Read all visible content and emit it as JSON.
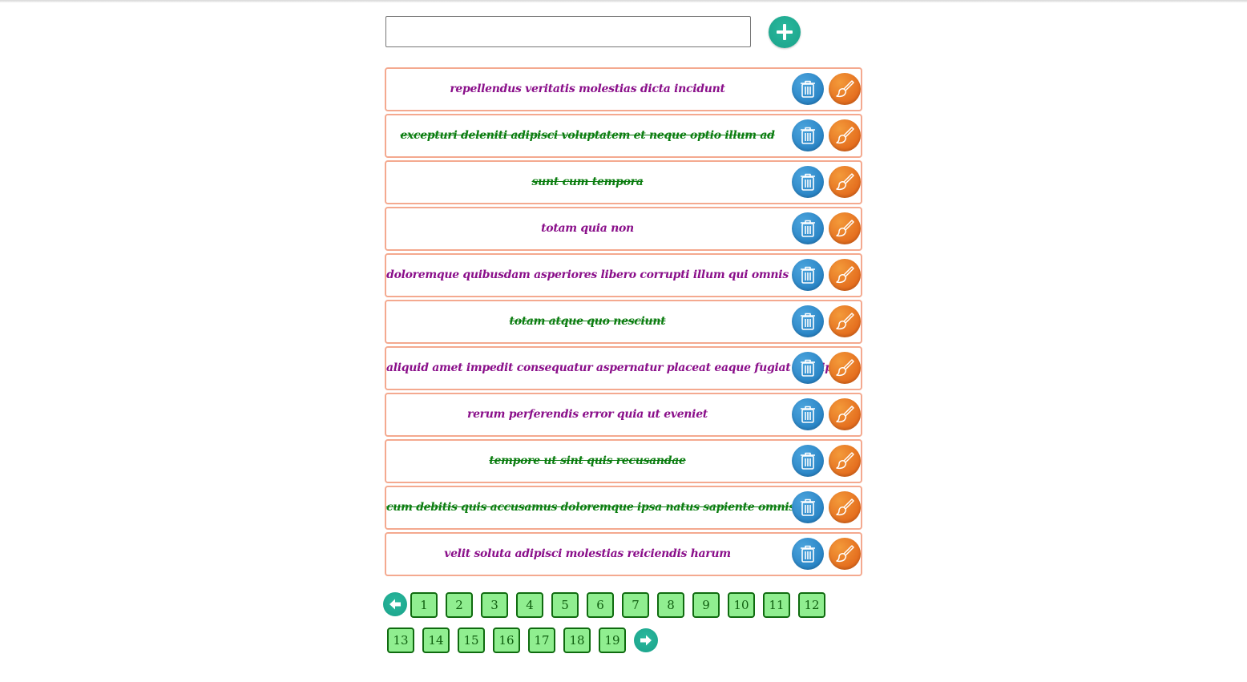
{
  "input": {
    "value": "",
    "placeholder": ""
  },
  "todos": [
    {
      "text": "repellendus veritatis molestias dicta incidunt",
      "completed": false
    },
    {
      "text": "excepturi deleniti adipisci voluptatem et neque optio illum ad",
      "completed": true
    },
    {
      "text": "sunt cum tempora",
      "completed": true
    },
    {
      "text": "totam quia non",
      "completed": false
    },
    {
      "text": "doloremque quibusdam asperiores libero corrupti illum qui omnis",
      "completed": false
    },
    {
      "text": "totam atque quo nesciunt",
      "completed": true
    },
    {
      "text": "aliquid amet impedit consequatur aspernatur placeat eaque fugiat suscipit",
      "completed": false
    },
    {
      "text": "rerum perferendis error quia ut eveniet",
      "completed": false
    },
    {
      "text": "tempore ut sint quis recusandae",
      "completed": true
    },
    {
      "text": "cum debitis quis accusamus doloremque ipsa natus sapiente omnis",
      "completed": true
    },
    {
      "text": "velit soluta adipisci molestias reiciendis harum",
      "completed": false
    }
  ],
  "pagination": {
    "pages": [
      "1",
      "2",
      "3",
      "4",
      "5",
      "6",
      "7",
      "8",
      "9",
      "10",
      "11",
      "12",
      "13",
      "14",
      "15",
      "16",
      "17",
      "18",
      "19"
    ]
  },
  "icons": {
    "add": "plus-icon",
    "delete": "trash-icon",
    "edit": "brush-icon",
    "prev": "arrow-left-icon",
    "next": "arrow-right-icon"
  },
  "colors": {
    "accent_teal": "#1aa28a",
    "delete_blue": "#2a85c6",
    "edit_orange": "#e46d1e",
    "item_border": "#f4a98f",
    "pending_text": "#8a0f8a",
    "done_text": "#0b7d10",
    "page_bg": "#90ee90",
    "page_border": "#0f6b0f"
  }
}
